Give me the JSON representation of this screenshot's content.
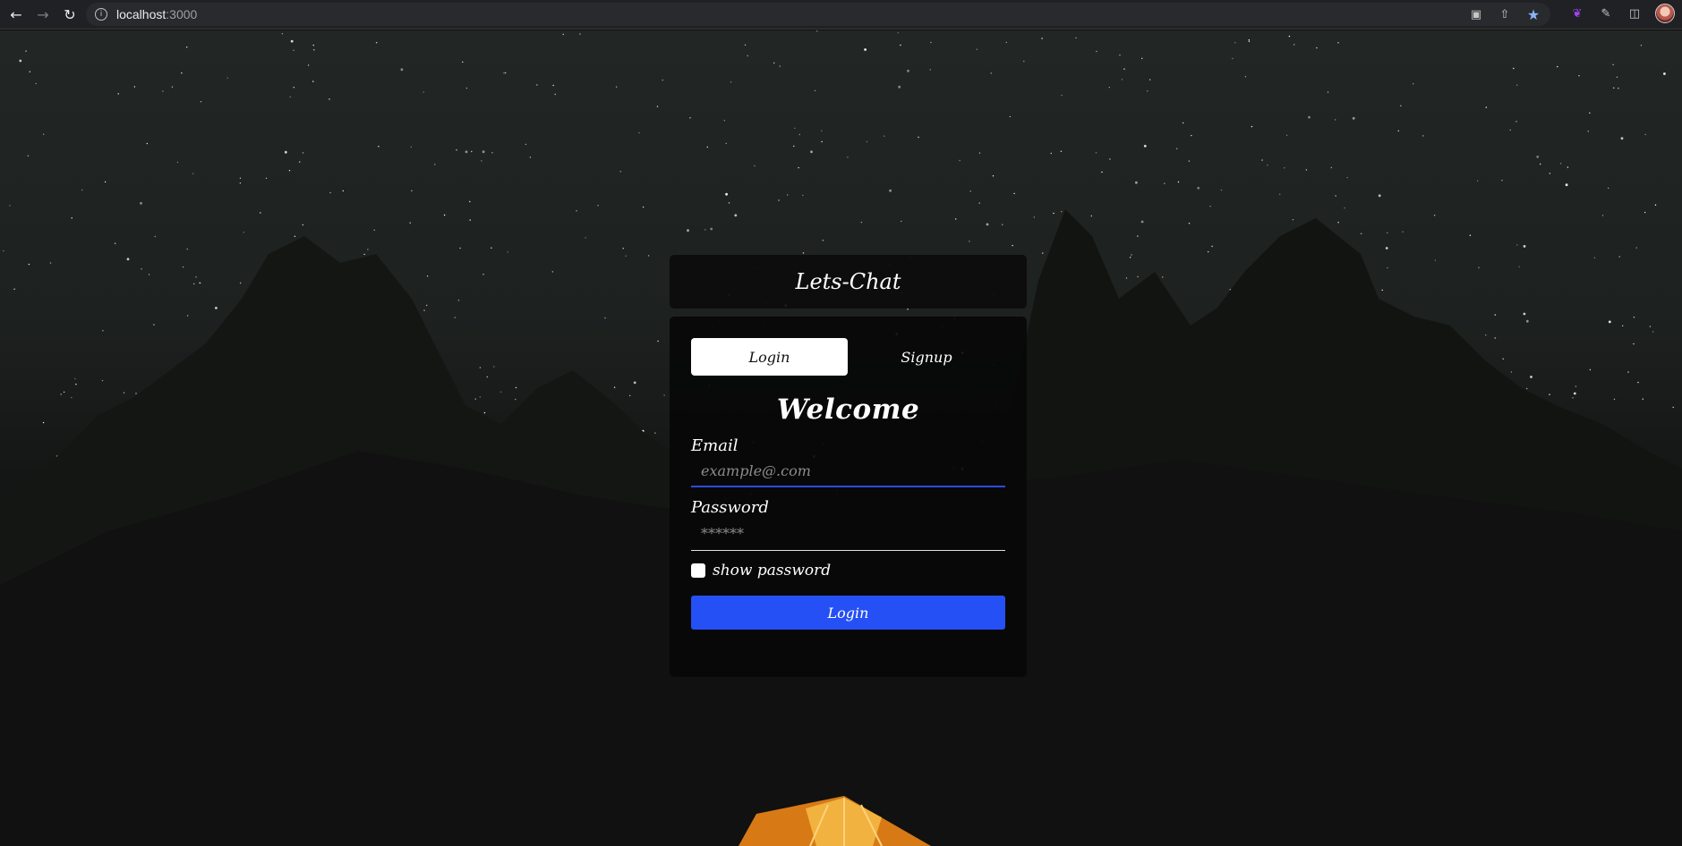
{
  "browser": {
    "url_host": "localhost",
    "url_port": ":3000",
    "icons": [
      "back-icon",
      "forward-icon",
      "reload-icon",
      "info-icon",
      "translate-icon",
      "share-icon",
      "bookmark-star-icon",
      "feather-extension-icon",
      "extensions-icon",
      "side-panel-icon",
      "profile-avatar"
    ]
  },
  "app": {
    "title": "Lets-Chat"
  },
  "tabs": {
    "login_label": "Login",
    "signup_label": "Signup",
    "active": "Login"
  },
  "form": {
    "heading": "Welcome",
    "email_label": "Email",
    "email_placeholder": "example@.com",
    "email_value": "",
    "password_label": "Password",
    "password_placeholder": "******",
    "password_value": "",
    "show_password_label": "show password",
    "show_password_checked": false,
    "submit_label": "Login"
  },
  "colors": {
    "accent": "#2550f5",
    "focus_underline": "#2c4bde",
    "card_bg": "#0c0c0c"
  }
}
